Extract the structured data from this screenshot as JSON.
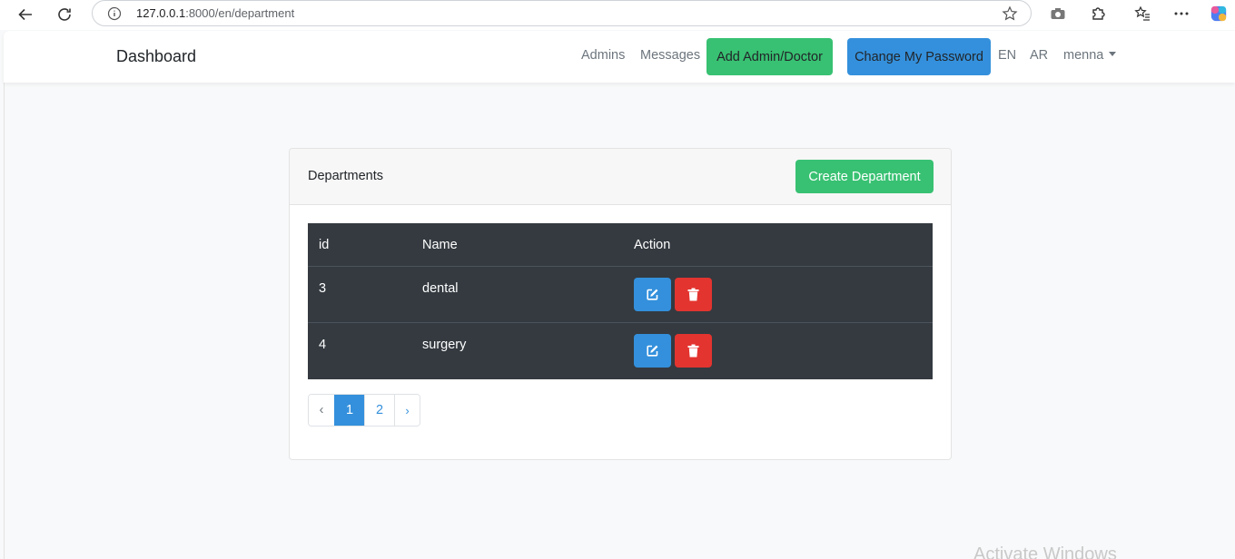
{
  "browser": {
    "url_host": "127.0.0.1",
    "url_path": ":8000/en/department"
  },
  "navbar": {
    "brand": "Dashboard",
    "links": [
      "Admins",
      "Messages"
    ],
    "add_button": "Add Admin/Doctor",
    "password_button": "Change My Password",
    "lang_en": "EN",
    "lang_ar": "AR",
    "user": "menna"
  },
  "card": {
    "title": "Departments",
    "create_button": "Create Department",
    "columns": [
      "id",
      "Name",
      "Action"
    ],
    "rows": [
      {
        "id": "3",
        "name": "dental"
      },
      {
        "id": "4",
        "name": "surgery"
      }
    ]
  },
  "pagination": {
    "prev": "‹",
    "pages": [
      "1",
      "2"
    ],
    "active": "1",
    "next": "›"
  },
  "colors": {
    "success": "#38c172",
    "primary": "#3490dc",
    "danger": "#e3342f",
    "dark": "#343a40"
  },
  "watermark": "Activate Windows"
}
